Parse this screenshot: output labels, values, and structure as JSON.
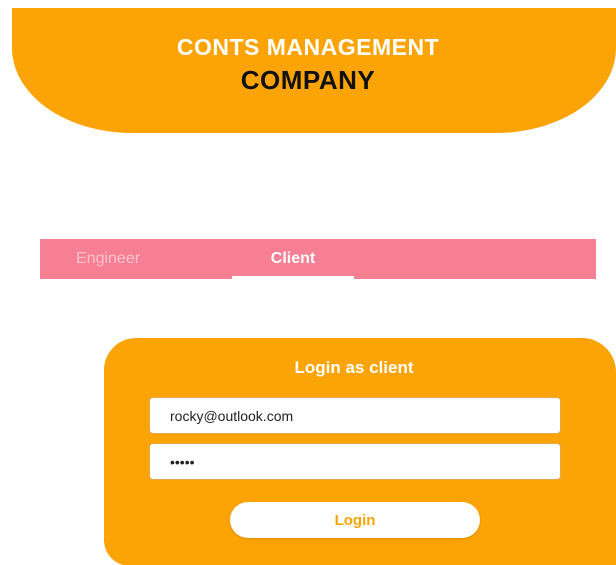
{
  "header": {
    "title_line1": "CONTS MANAGEMENT",
    "title_line2": "COMPANY"
  },
  "tabs": {
    "items": [
      {
        "label": "Engineer",
        "selected": false
      },
      {
        "label": "Client",
        "selected": true
      }
    ]
  },
  "login": {
    "title": "Login as client",
    "email_value": "rocky@outlook.com",
    "password_value": "•••••",
    "button_label": "Login"
  },
  "colors": {
    "accent": "#fca405",
    "tabbar": "#f77f94",
    "background": "#ffffff"
  }
}
